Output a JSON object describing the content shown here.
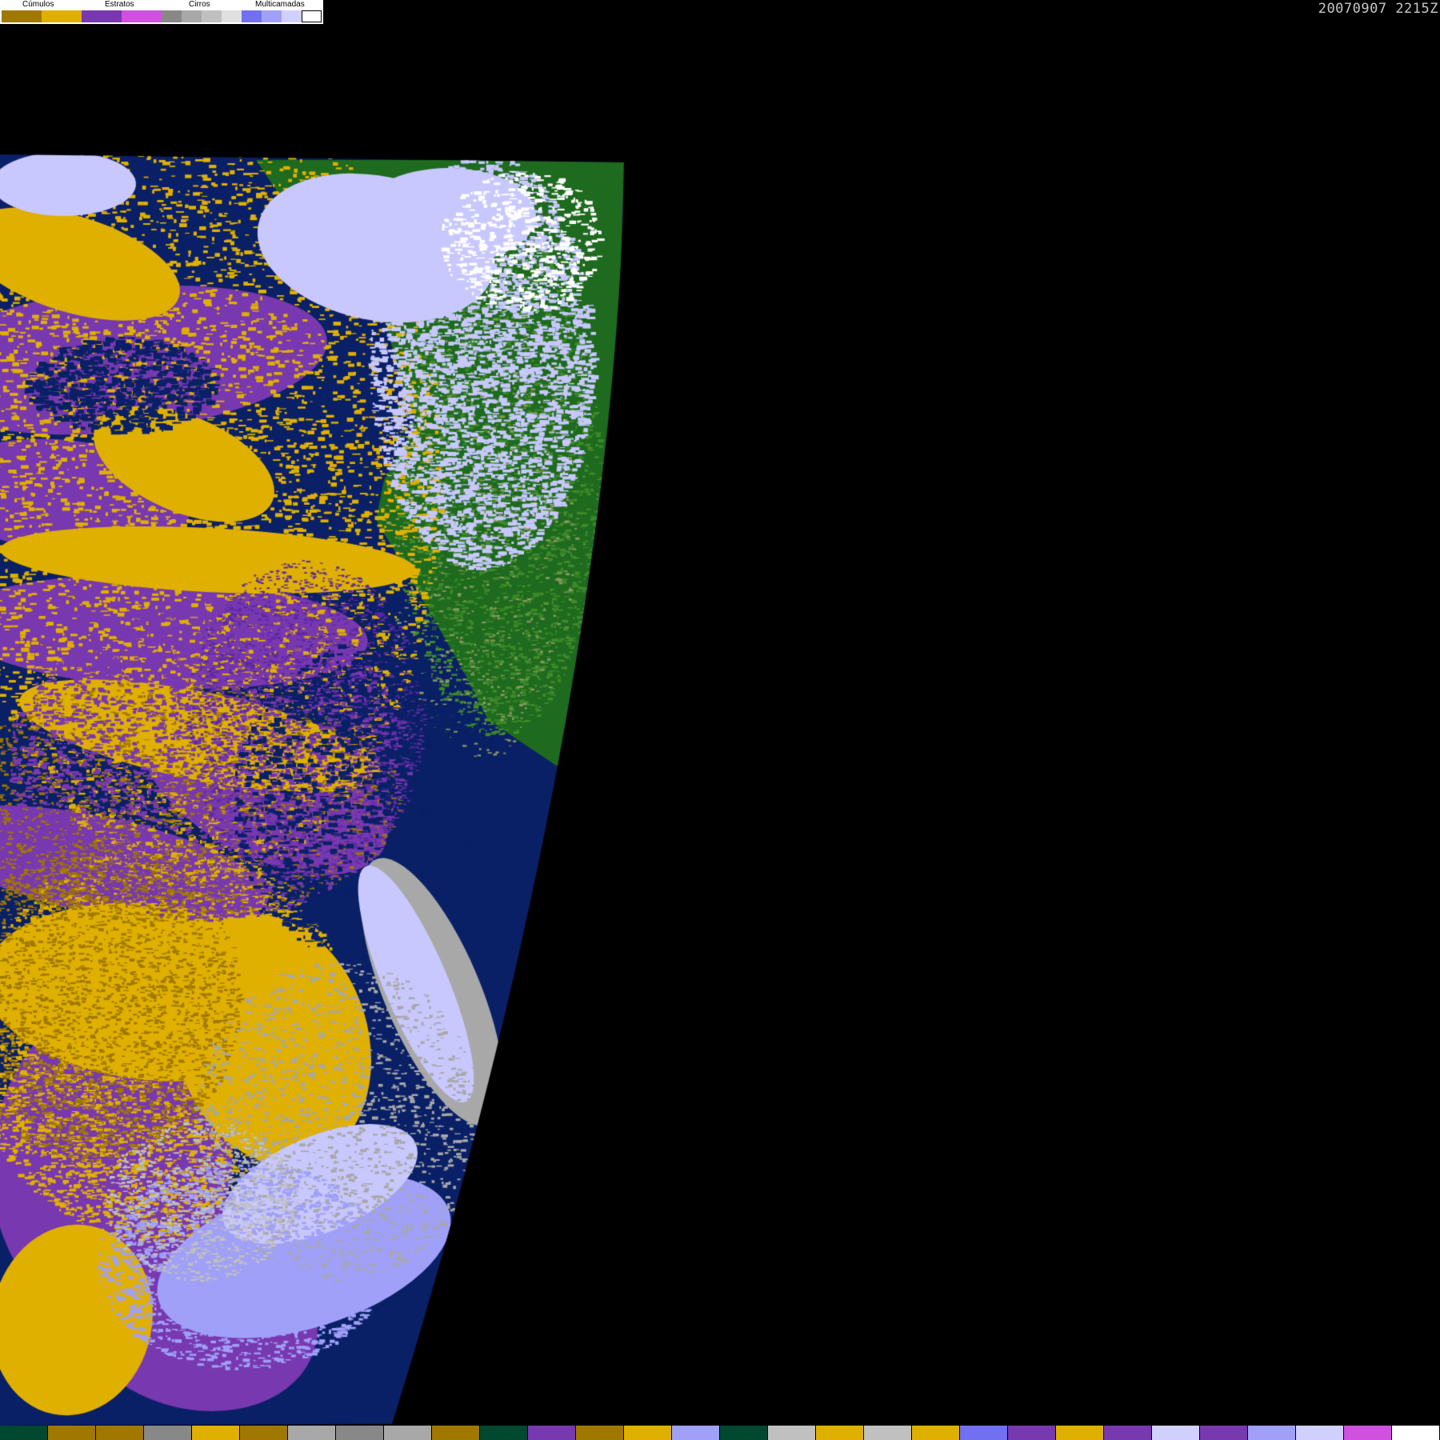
{
  "timestamp": "20070907  2215Z",
  "legend": {
    "groups": [
      {
        "label": "Cúmulos",
        "swatches": [
          "#a07800",
          "#e0b000"
        ]
      },
      {
        "label": "Estratos",
        "swatches": [
          "#7838b0",
          "#d050e0"
        ]
      },
      {
        "label": "Cirros",
        "swatches": [
          "#888888",
          "#a8a8a8",
          "#c0c0c0",
          "#e0e0e0"
        ]
      },
      {
        "label": "Multicamadas",
        "swatches": [
          "#7070f0",
          "#a0a0f8",
          "#d0d0ff",
          "#ffffff"
        ]
      }
    ]
  },
  "colors": {
    "background": "#000000",
    "ocean": "#0a2066",
    "land": "#1e6a1e",
    "cumulus": "#e0b000",
    "stratus": "#7838b0",
    "cirrus": "#a8a8a8",
    "multilayer": "#c8c8ff"
  },
  "bottom_strip": [
    "#004830",
    "#a07800",
    "#a07800",
    "#888888",
    "#e0b000",
    "#a07800",
    "#a8a8a8",
    "#888888",
    "#a8a8a8",
    "#a07800",
    "#004830",
    "#7838b0",
    "#a07800",
    "#e0b000",
    "#a0a0f8",
    "#004830",
    "#c0c0c0",
    "#e0b000",
    "#c0c0c0",
    "#e0b000",
    "#7070f0",
    "#7838b0",
    "#e0b000",
    "#7838b0",
    "#d0d0ff",
    "#7838b0",
    "#a0a0f8",
    "#d0d0ff",
    "#d050e0",
    "#ffffff"
  ]
}
